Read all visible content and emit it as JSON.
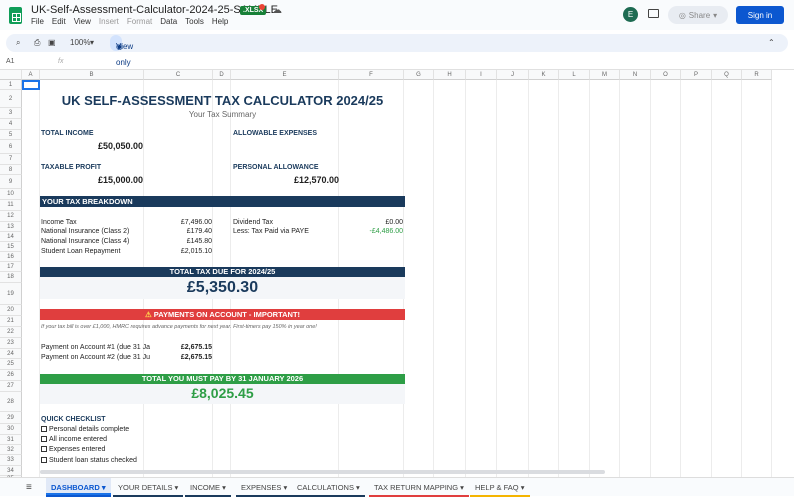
{
  "app": {
    "doc_title": "UK-Self-Assessment-Calculator-2024-25-SAMPLE",
    "file_badge": ".XLSX",
    "menu": [
      "File",
      "Edit",
      "View",
      "Insert",
      "Format",
      "Data",
      "Tools",
      "Help"
    ],
    "avatar_letter": "E",
    "share_label": "Share",
    "signin_label": "Sign in",
    "zoom": "100%",
    "view_only_label": "View only",
    "cell_ref": "A1",
    "fx": "fx"
  },
  "columns": [
    "A",
    "B",
    "C",
    "D",
    "E",
    "F",
    "G",
    "H",
    "I",
    "J",
    "K",
    "L",
    "M",
    "N",
    "O",
    "P",
    "Q",
    "R"
  ],
  "rows": [
    "1",
    "2",
    "3",
    "4",
    "5",
    "6",
    "7",
    "8",
    "9",
    "10",
    "11",
    "12",
    "13",
    "14",
    "15",
    "16",
    "17",
    "18",
    "19",
    "20",
    "21",
    "22",
    "23",
    "24",
    "25",
    "26",
    "27",
    "28",
    "29",
    "30",
    "31",
    "32",
    "33",
    "34",
    "35"
  ],
  "content": {
    "title": "UK SELF-ASSESSMENT TAX CALCULATOR 2024/25",
    "subtitle": "Your Tax Summary",
    "total_income_label": "TOTAL INCOME",
    "total_income_value": "£50,050.00",
    "allowable_expenses_label": "ALLOWABLE EXPENSES",
    "taxable_profit_label": "TAXABLE PROFIT",
    "taxable_profit_value": "£15,000.00",
    "personal_allowance_label": "PERSONAL ALLOWANCE",
    "personal_allowance_value": "£12,570.00",
    "breakdown_header": "YOUR TAX BREAKDOWN",
    "breakdown_left": [
      {
        "label": "Income Tax",
        "value": "£7,496.00"
      },
      {
        "label": "National Insurance (Class 2)",
        "value": "£179.40"
      },
      {
        "label": "National Insurance (Class 4)",
        "value": "£145.80"
      },
      {
        "label": "Student Loan Repayment",
        "value": "£2,015.10"
      }
    ],
    "dividend_tax_label": "Dividend Tax",
    "dividend_tax_value": "£0.00",
    "paye_label": "Less: Tax Paid via PAYE",
    "paye_value": "-£4,486.00",
    "total_due_header": "TOTAL TAX DUE FOR 2024/25",
    "total_due_value": "£5,350.30",
    "poa_header": "PAYMENTS ON ACCOUNT - IMPORTANT!",
    "poa_note": "If your tax bill is over £1,000, HMRC requires advance payments for next year. First-timers pay 150% in year one!",
    "poa_rows": [
      {
        "label": "Payment on Account #1 (due 31 Ja",
        "value": "£2,675.15"
      },
      {
        "label": "Payment on Account #2 (due 31 Ju",
        "value": "£2,675.15"
      }
    ],
    "total_pay_header": "TOTAL YOU MUST PAY BY 31 JANUARY 2026",
    "total_pay_value": "£8,025.45",
    "checklist_header": "QUICK CHECKLIST",
    "checklist": [
      "Personal details complete",
      "All income entered",
      "Expenses entered",
      "Student loan status checked"
    ]
  },
  "tabs": [
    {
      "label": "DASHBOARD",
      "color": "#1a73e8"
    },
    {
      "label": "YOUR DETAILS",
      "color": "#1a3a5c"
    },
    {
      "label": "INCOME",
      "color": "#1a3a5c"
    },
    {
      "label": "EXPENSES",
      "color": "#1a3a5c"
    },
    {
      "label": "CALCULATIONS",
      "color": "#1a3a5c"
    },
    {
      "label": "TAX RETURN MAPPING",
      "color": "#e03e3e"
    },
    {
      "label": "HELP & FAQ",
      "color": "#f4b400"
    }
  ],
  "colors": {
    "navy": "#1a3a5c",
    "red": "#e03e3e",
    "green": "#2e9e46",
    "paye_green": "#2e9e46"
  },
  "icons": [
    "sheets-logo-icon",
    "cloud-icon",
    "comment-icon",
    "search-icon",
    "print-icon",
    "paint-format-icon",
    "eye-icon",
    "chevron-up-icon",
    "warning-icon",
    "all-sheets-icon"
  ]
}
